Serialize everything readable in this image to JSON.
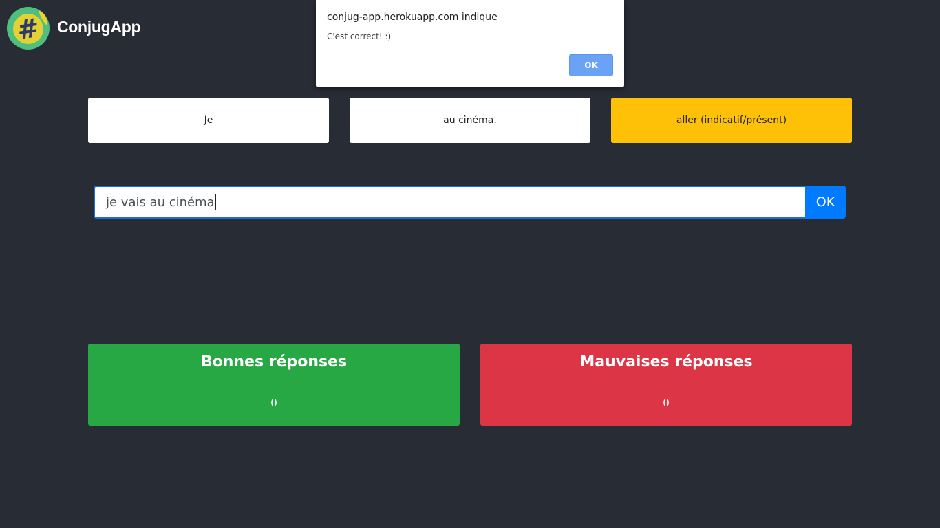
{
  "app": {
    "name": "ConjugApp",
    "logo_icon": "hashtag-lemon-icon",
    "logo_glyph": "#"
  },
  "exercise": {
    "subject": "Je",
    "complement": "au cinéma.",
    "verb_prompt": "aller (indicatif/présent)"
  },
  "answer": {
    "value": "je vais au cinéma",
    "submit_label": "OK"
  },
  "scores": {
    "good": {
      "title": "Bonnes réponses",
      "count": "0"
    },
    "bad": {
      "title": "Mauvaises réponses",
      "count": "0"
    }
  },
  "dialog": {
    "origin": "conjug-app.herokuapp.com indique",
    "message": "C'est correct! :)",
    "ok_label": "OK"
  },
  "colors": {
    "background": "#282c35",
    "verb_box": "#ffc107",
    "submit": "#007bff",
    "good": "#28a745",
    "bad": "#dc3545",
    "logo_circle": "#4fbf7f",
    "logo_glyph": "#2f3a66"
  }
}
